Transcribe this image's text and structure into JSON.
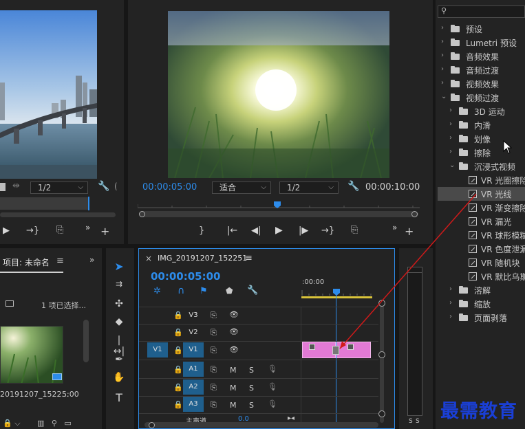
{
  "source_monitor": {
    "resolution": "1/2",
    "controls": [
      "⏭",
      "⇥",
      "⎘"
    ]
  },
  "program_monitor": {
    "timecode_current": "00:00:05:00",
    "zoom": "适合",
    "resolution": "1/2",
    "timecode_duration": "00:00:10:00"
  },
  "project_panel": {
    "title": "项目: 未命名",
    "menu_icon": "≡",
    "selection_info": "1 项已选择...",
    "clip_name": "20191207_1522...",
    "clip_duration": "5:00"
  },
  "timeline": {
    "close": "×",
    "title": "IMG_20191207_152251",
    "menu_icon": "≡",
    "timecode": "00:00:05:00",
    "ruler_label": ":00:00",
    "source_patch": "V1",
    "tracks": [
      {
        "id": "V3",
        "label": "V3"
      },
      {
        "id": "V2",
        "label": "V2"
      },
      {
        "id": "V1",
        "label": "V1"
      },
      {
        "id": "A1",
        "label": "A1",
        "m": "M",
        "s": "S"
      },
      {
        "id": "A2",
        "label": "A2",
        "m": "M",
        "s": "S"
      },
      {
        "id": "A3",
        "label": "A3",
        "m": "M",
        "s": "S"
      }
    ],
    "master_label": "主声道",
    "master_value": "0.0"
  },
  "meter": {
    "s1": "S",
    "s2": "S"
  },
  "effects_panel": {
    "search_placeholder": "",
    "items": [
      {
        "label": "预设",
        "level": 0,
        "type": "folder",
        "expanded": false
      },
      {
        "label": "Lumetri 预设",
        "level": 0,
        "type": "folder",
        "expanded": false
      },
      {
        "label": "音频效果",
        "level": 0,
        "type": "folder",
        "expanded": false
      },
      {
        "label": "音频过渡",
        "level": 0,
        "type": "folder",
        "expanded": false
      },
      {
        "label": "视频效果",
        "level": 0,
        "type": "folder",
        "expanded": false
      },
      {
        "label": "视频过渡",
        "level": 0,
        "type": "folder",
        "expanded": true
      },
      {
        "label": "3D 运动",
        "level": 1,
        "type": "folder",
        "expanded": false
      },
      {
        "label": "内滑",
        "level": 1,
        "type": "folder",
        "expanded": false
      },
      {
        "label": "划像",
        "level": 1,
        "type": "folder",
        "expanded": false
      },
      {
        "label": "擦除",
        "level": 1,
        "type": "folder",
        "expanded": false
      },
      {
        "label": "沉浸式视频",
        "level": 1,
        "type": "folder",
        "expanded": true
      },
      {
        "label": "VR 光圈擦除",
        "level": 2,
        "type": "effect"
      },
      {
        "label": "VR 光线",
        "level": 2,
        "type": "effect",
        "selected": true
      },
      {
        "label": "VR 渐变擦除",
        "level": 2,
        "type": "effect"
      },
      {
        "label": "VR 漏光",
        "level": 2,
        "type": "effect"
      },
      {
        "label": "VR 球形模糊",
        "level": 2,
        "type": "effect"
      },
      {
        "label": "VR 色度泄漏",
        "level": 2,
        "type": "effect"
      },
      {
        "label": "VR 随机块",
        "level": 2,
        "type": "effect"
      },
      {
        "label": "VR 默比乌斯",
        "level": 2,
        "type": "effect"
      },
      {
        "label": "溶解",
        "level": 1,
        "type": "folder",
        "expanded": false
      },
      {
        "label": "缩放",
        "level": 1,
        "type": "folder",
        "expanded": false
      },
      {
        "label": "页面剥落",
        "level": 1,
        "type": "folder",
        "expanded": false
      }
    ]
  },
  "watermark": "最需教育",
  "colors": {
    "accent_blue": "#2d8ceb",
    "clip_pink": "#e27ad5",
    "arrow_red": "#d01a1a",
    "watermark_blue": "#1a3fd6"
  }
}
